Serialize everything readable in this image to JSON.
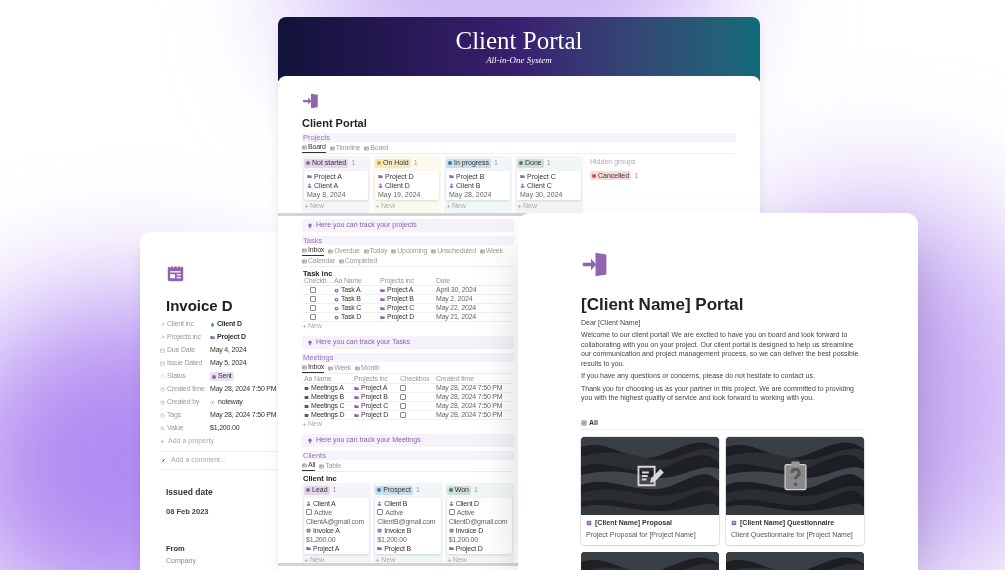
{
  "portal_overview": {
    "banner": {
      "title": "Client Portal",
      "subtitle": "All-in-One System"
    },
    "title": "Client Portal",
    "projects": {
      "heading": "Projects",
      "tabs": [
        {
          "label": "Board",
          "selected": true
        },
        {
          "label": "Timeline",
          "selected": false
        },
        {
          "label": "Board",
          "selected": false
        }
      ],
      "groups": [
        {
          "label": "Not started",
          "count": "1",
          "color": "#9065b0",
          "cards": [
            {
              "title": "Project A",
              "client": "Client A",
              "date": "May 8, 2024"
            }
          ],
          "new": "New"
        },
        {
          "label": "On Hold",
          "count": "1",
          "color": "#d9a30d",
          "cards": [
            {
              "title": "Project D",
              "client": "Client D",
              "date": "May 19, 2024"
            }
          ],
          "new": "New"
        },
        {
          "label": "In progress",
          "count": "1",
          "color": "#337ea9",
          "cards": [
            {
              "title": "Project B",
              "client": "Client B",
              "date": "May 28, 2024"
            }
          ],
          "new": "New"
        },
        {
          "label": "Done",
          "count": "1",
          "color": "#448361",
          "cards": [
            {
              "title": "Project C",
              "client": "Client C",
              "date": "May 30, 2024"
            }
          ],
          "new": "New"
        }
      ],
      "hidden_groups": {
        "label": "Hidden groups",
        "groups": [
          {
            "label": "Cancelled",
            "count": "1",
            "color": "#d44c47"
          }
        ]
      }
    },
    "projects_callout": "Here you can track your projects",
    "tasks": {
      "heading": "Tasks",
      "tabs": [
        {
          "label": "Inbox",
          "selected": true
        },
        {
          "label": "Overdue",
          "selected": false
        },
        {
          "label": "Today",
          "selected": false
        },
        {
          "label": "Upcoming",
          "selected": false
        },
        {
          "label": "Unscheduled",
          "selected": false
        },
        {
          "label": "Week",
          "selected": false
        },
        {
          "label": "Calendar",
          "selected": false
        },
        {
          "label": "Completed",
          "selected": false
        }
      ],
      "view_title": "Task inc",
      "columns": [
        "Checkb…",
        "Aa Name",
        "Projects inc",
        "Date"
      ],
      "rows": [
        {
          "checked": false,
          "name": "Task A",
          "project": "Project A",
          "date": "April 30, 2024"
        },
        {
          "checked": false,
          "name": "Task B",
          "project": "Project B",
          "date": "May 2, 2024"
        },
        {
          "checked": false,
          "name": "Task C",
          "project": "Project C",
          "date": "May 22, 2024"
        },
        {
          "checked": false,
          "name": "Task D",
          "project": "Project D",
          "date": "May 21, 2024"
        }
      ],
      "new": "New"
    },
    "tasks_callout": "Here you can track your Tasks",
    "meetings": {
      "heading": "Meetings",
      "tabs": [
        {
          "label": "Inbox",
          "selected": true
        },
        {
          "label": "Week",
          "selected": false
        },
        {
          "label": "Month",
          "selected": false
        }
      ],
      "columns": [
        "Aa Name",
        "Projects inc",
        "Checkbox",
        "Created time"
      ],
      "rows": [
        {
          "name": "Meetings A",
          "project": "Project A",
          "checked": false,
          "created": "May 28, 2024 7:50 PM"
        },
        {
          "name": "Meetings B",
          "project": "Project B",
          "checked": false,
          "created": "May 28, 2024 7:50 PM"
        },
        {
          "name": "Meetings C",
          "project": "Project C",
          "checked": false,
          "created": "May 28, 2024 7:50 PM"
        },
        {
          "name": "Meetings D",
          "project": "Project D",
          "checked": false,
          "created": "May 28, 2024 7:50 PM"
        }
      ],
      "new": "New"
    },
    "meetings_callout": "Here you can track your Meetings",
    "clients": {
      "heading": "Clients",
      "tabs": [
        {
          "label": "All",
          "selected": true
        },
        {
          "label": "Table",
          "selected": false
        }
      ],
      "view_title": "Client inc",
      "groups": [
        {
          "label": "Lead",
          "count": "1",
          "color": "#9065b0",
          "cards": [
            {
              "name": "Client A",
              "active_label": "Active",
              "active": false,
              "email": "ClientA@gmail.com",
              "invoice": "Invoice A",
              "value": "$1,200.00",
              "project": "Project A"
            }
          ],
          "new": "New"
        },
        {
          "label": "Prospect",
          "count": "1",
          "color": "#337ea9",
          "cards": [
            {
              "name": "Client B",
              "active_label": "Active",
              "active": false,
              "email": "ClientB@gmail.com",
              "invoice": "Invoice B",
              "value": "$1,200.00",
              "project": "Project B"
            }
          ],
          "new": "New"
        },
        {
          "label": "Won",
          "count": "1",
          "color": "#448361",
          "cards": [
            {
              "name": "Client D",
              "active_label": "Active",
              "active": false,
              "email": "ClientD@gmail.com",
              "invoice": "Invoice D",
              "value": "$1,200.00",
              "project": "Project D"
            }
          ],
          "new": "New"
        }
      ]
    }
  },
  "invoice_page": {
    "title": "Invoice D",
    "properties": [
      {
        "kind": "client",
        "label": "Client inc",
        "value": "Client D"
      },
      {
        "kind": "project",
        "label": "Projects inc",
        "value": "Project D"
      },
      {
        "kind": "date",
        "label": "Due Date",
        "value": "May 4, 2024"
      },
      {
        "kind": "date",
        "label": "Issue Dated",
        "value": "May 5, 2024"
      },
      {
        "kind": "status",
        "label": "Status",
        "value": "Sent",
        "color": "#9065b0"
      },
      {
        "kind": "time",
        "label": "Created time",
        "value": "May 28, 2024 7:50 PM"
      },
      {
        "kind": "person",
        "label": "Created by",
        "value": "noteway"
      },
      {
        "kind": "time",
        "label": "Tags",
        "value": "May 28, 2024 7:50 PM"
      },
      {
        "kind": "amount",
        "label": "Value",
        "value": "$1,200.00"
      }
    ],
    "add_property": "Add a property",
    "comment_placeholder": "Add a comment...",
    "issued_heading": "Issued date",
    "issued_date": "08 Feb 2023",
    "from_heading": "From",
    "from_company": "Company"
  },
  "client_portal_page": {
    "title": "[Client Name] Portal",
    "greeting": "Dear [Client Name]",
    "paragraphs": [
      "Welcome to our client portal! We are excited to have you on board and look forward to collaborating with you on your project. Our client portal is designed to help us streamline our communication and project management process, so we can deliver the best possible results to you.",
      "If you have any questions or concerns, please do not hesitate to contact us.",
      "Thank you for choosing us as your partner in this project. We are committed to providing you with the highest quality of service and look forward to working with you."
    ],
    "view_tab": {
      "label": "All",
      "selected": true
    },
    "cards": [
      {
        "kind": "proposal",
        "title": "[Client Name] Proposal",
        "subtitle": "Project Proposal for [Project Name]"
      },
      {
        "kind": "questionnaire",
        "title": "[Client Name] Questionnaire",
        "subtitle": "Client Questionnaire for [Project Name]"
      },
      {
        "kind": "picture"
      },
      {
        "kind": "picture"
      }
    ]
  }
}
